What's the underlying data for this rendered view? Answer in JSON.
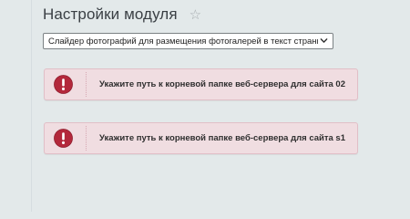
{
  "header": {
    "title": "Настройки модуля",
    "favorite_icon": "star-icon"
  },
  "module_select": {
    "selected_value": "Слайдер фотографий для размещения фотогалерей в текст страниц",
    "arrow_icon": "chevron-down-icon"
  },
  "alerts": [
    {
      "icon": "error-exclamation-icon",
      "message": "Укажите путь к корневой папке веб-сервера для сайта 02"
    },
    {
      "icon": "error-exclamation-icon",
      "message": "Укажите путь к корневой папке веб-сервера для сайта s1"
    }
  ],
  "colors": {
    "background": "#e3e9ea",
    "alert_background": "#f0dde1",
    "alert_border": "#e1bfc7",
    "error_icon": "#b3283b"
  }
}
